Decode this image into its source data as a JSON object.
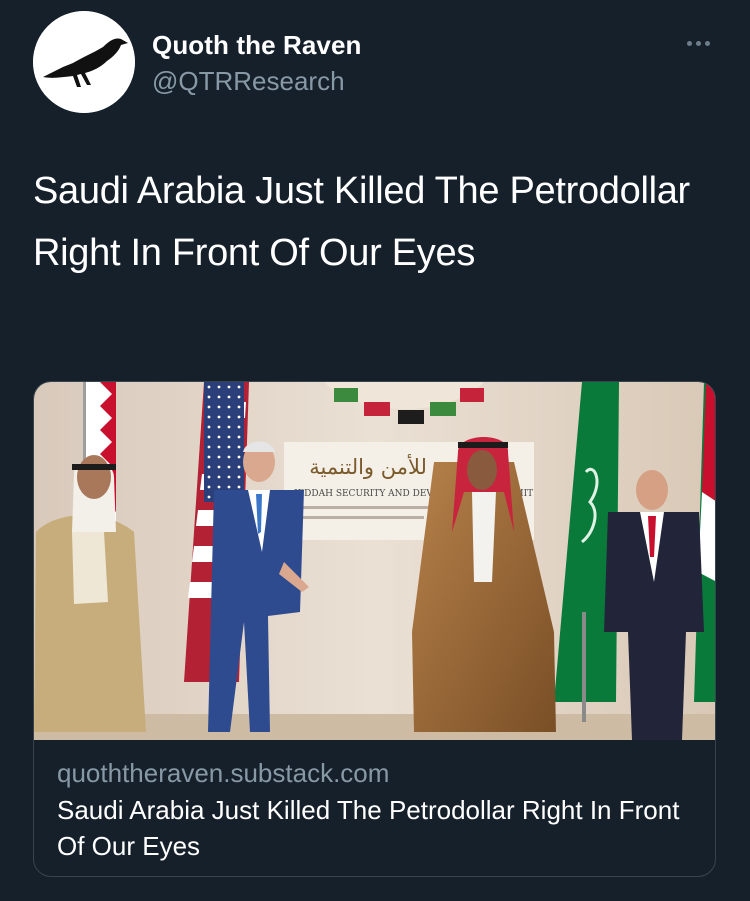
{
  "tweet": {
    "author_name": "Quoth the Raven",
    "author_handle": "@QTRResearch",
    "text": "Saudi Arabia Just Killed The Petrodollar Right In Front Of Our Eyes",
    "more_icon": "more-horizontal-icon"
  },
  "link_card": {
    "domain": "quoththeraven.substack.com",
    "title": "Saudi Arabia Just Killed The Petrodollar Right In Front Of Our Eyes",
    "image": {
      "sign_arabic": "قمة جدة للأمن والتنمية",
      "sign_english": "JEDDAH SECURITY AND DEVELOPMENT SUMMIT"
    }
  },
  "colors": {
    "background": "#15202b",
    "secondary_text": "#8899a6",
    "card_border": "#38444d"
  }
}
